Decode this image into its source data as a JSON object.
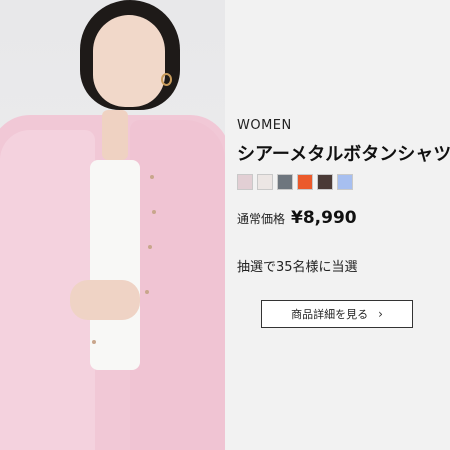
{
  "product": {
    "category": "WOMEN",
    "name": "シアーメタルボタンシャツ",
    "price_label": "通常価格",
    "price": "¥8,990"
  },
  "swatches": [
    {
      "name": "pink",
      "color": "#e2cfd4"
    },
    {
      "name": "off-white",
      "color": "#ece6e4"
    },
    {
      "name": "gray",
      "color": "#6e767e"
    },
    {
      "name": "orange",
      "color": "#eb5a2b"
    },
    {
      "name": "dark-brown",
      "color": "#4a3a36"
    },
    {
      "name": "light-blue",
      "color": "#a7bff0"
    }
  ],
  "promotion": {
    "text": "抽選で35名様に当選"
  },
  "cta": {
    "label": "商品詳細を見る",
    "icon": "chevron-right-icon"
  }
}
